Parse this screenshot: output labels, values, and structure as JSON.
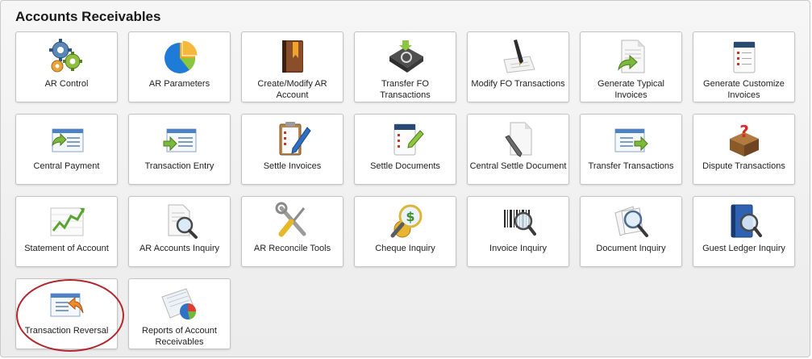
{
  "panel": {
    "title": "Accounts Receivables"
  },
  "tiles": [
    {
      "label": "AR Control",
      "icon": "gears-icon"
    },
    {
      "label": "AR Parameters",
      "icon": "pie-chart-icon"
    },
    {
      "label": "Create/Modify AR Account",
      "icon": "account-book-icon"
    },
    {
      "label": "Transfer FO Transactions",
      "icon": "recycle-box-icon"
    },
    {
      "label": "Modify FO Transactions",
      "icon": "pen-paper-icon"
    },
    {
      "label": "Generate Typical Invoices",
      "icon": "invoice-arrow-icon"
    },
    {
      "label": "Generate Customize Invoices",
      "icon": "checklist-calendar-icon"
    },
    {
      "label": "Central Payment",
      "icon": "window-arrow-icon"
    },
    {
      "label": "Transaction Entry",
      "icon": "window-entry-icon"
    },
    {
      "label": "Settle Invoices",
      "icon": "clipboard-pen-icon"
    },
    {
      "label": "Settle Documents",
      "icon": "checklist-pencil-icon"
    },
    {
      "label": "Central Settle Document",
      "icon": "document-pen-icon"
    },
    {
      "label": "Transfer Transactions",
      "icon": "window-transfer-icon"
    },
    {
      "label": "Dispute Transactions",
      "icon": "question-box-icon"
    },
    {
      "label": "Statement of Account",
      "icon": "line-chart-icon"
    },
    {
      "label": "AR Accounts Inquiry",
      "icon": "document-search-icon"
    },
    {
      "label": "AR Reconcile Tools",
      "icon": "tools-icon"
    },
    {
      "label": "Cheque Inquiry",
      "icon": "coin-search-icon"
    },
    {
      "label": "Invoice Inquiry",
      "icon": "barcode-search-icon"
    },
    {
      "label": "Document Inquiry",
      "icon": "papers-search-icon"
    },
    {
      "label": "Guest Ledger Inquiry",
      "icon": "book-search-icon"
    },
    {
      "label": "Transaction Reversal",
      "icon": "window-reverse-icon"
    },
    {
      "label": "Reports of Account Receivables",
      "icon": "report-chart-icon"
    }
  ],
  "colors": {
    "highlight_circle": "#b2272d"
  }
}
